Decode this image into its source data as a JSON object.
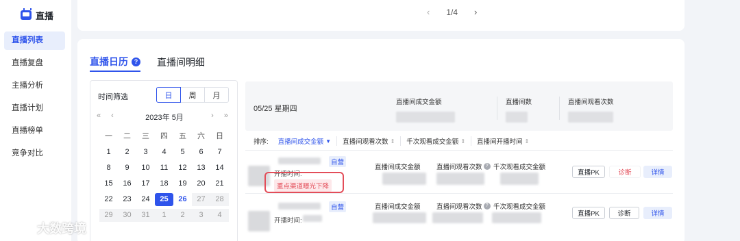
{
  "brand": {
    "label": "直播"
  },
  "sidebar": {
    "items": [
      {
        "label": "直播列表"
      },
      {
        "label": "直播复盘"
      },
      {
        "label": "主播分析"
      },
      {
        "label": "直播计划"
      },
      {
        "label": "直播榜单"
      },
      {
        "label": "竞争对比"
      }
    ]
  },
  "pager": {
    "text": "1/4"
  },
  "tabs": [
    {
      "label": "直播日历"
    },
    {
      "label": "直播间明细"
    }
  ],
  "calendar": {
    "filter_label": "时间筛选",
    "modes": [
      "日",
      "周",
      "月"
    ],
    "nav_left": "«  ‹",
    "nav_right": "›  »",
    "month": "2023年  5月",
    "weekdays": [
      "一",
      "二",
      "三",
      "四",
      "五",
      "六",
      "日"
    ],
    "weeks": [
      [
        "1",
        "2",
        "3",
        "4",
        "5",
        "6",
        "7"
      ],
      [
        "8",
        "9",
        "10",
        "11",
        "12",
        "13",
        "14"
      ],
      [
        "15",
        "16",
        "17",
        "18",
        "19",
        "20",
        "21"
      ],
      [
        "22",
        "23",
        "24",
        "25",
        "26",
        "27",
        "28"
      ],
      [
        "29",
        "30",
        "31",
        "1",
        "2",
        "3",
        "4"
      ]
    ],
    "selected_day": "25",
    "today": "26"
  },
  "summary": {
    "date": "05/25 星期四",
    "col1": "直播间成交金额",
    "col2": "直播间数",
    "col3": "直播间观看次数"
  },
  "sort": {
    "label": "排序:",
    "items": [
      "直播间成交金额",
      "直播间观看次数",
      "千次观看成交金额",
      "直播间开播时间"
    ]
  },
  "rows": [
    {
      "tag": "自营",
      "open_time": "开播时间:",
      "warning": "重点渠道曝光下降",
      "m1": "直播间成交金额",
      "m2": "直播间观看次数",
      "m3": "千次观看成交金额",
      "pk": "直播PK",
      "diag": "诊断",
      "detail": "详情"
    },
    {
      "tag": "自营",
      "open_time": "开播时间:",
      "m1": "直播间成交金额",
      "m2": "直播间观看次数",
      "m3": "千次观看成交金额",
      "pk": "直播PK",
      "diag": "诊断",
      "detail": "详情"
    }
  ],
  "watermark": {
    "text": "大数跨境"
  },
  "colors": {
    "accent": "#2f54eb",
    "danger": "#e34d59",
    "bg": "#f2f4f8"
  }
}
